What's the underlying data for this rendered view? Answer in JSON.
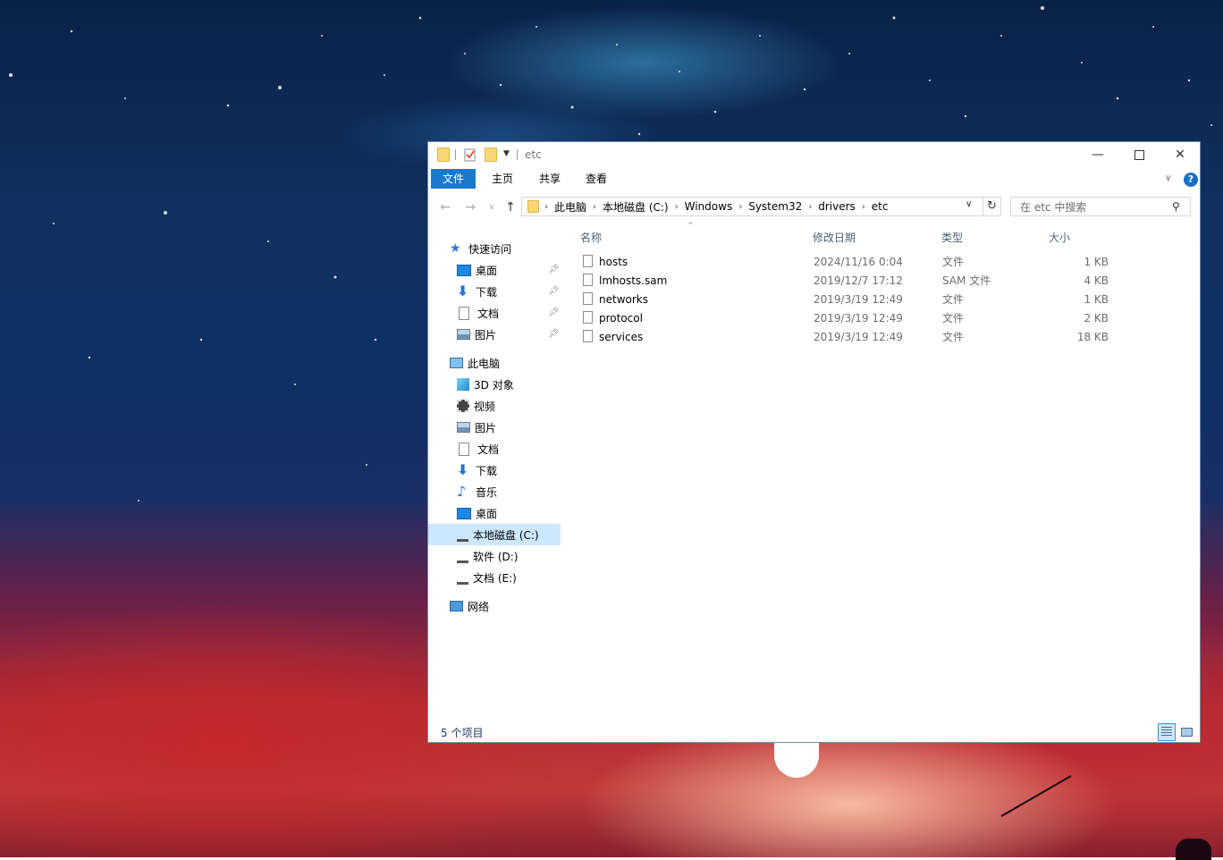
{
  "window": {
    "title": "etc",
    "ribbon_tabs": [
      "文件",
      "主页",
      "共享",
      "查看"
    ],
    "help_label": "?"
  },
  "address": {
    "crumbs": [
      "此电脑",
      "本地磁盘 (C:)",
      "Windows",
      "System32",
      "drivers",
      "etc"
    ]
  },
  "search": {
    "placeholder": "在 etc 中搜索"
  },
  "sidebar": {
    "quick_access": "快速访问",
    "quick_items": [
      "桌面",
      "下载",
      "文档",
      "图片"
    ],
    "this_pc": "此电脑",
    "pc_items": [
      "3D 对象",
      "视频",
      "图片",
      "文档",
      "下载",
      "音乐",
      "桌面",
      "本地磁盘 (C:)",
      "软件 (D:)",
      "文档 (E:)"
    ],
    "network": "网络",
    "selected": "本地磁盘 (C:)"
  },
  "columns": {
    "name": "名称",
    "date": "修改日期",
    "type": "类型",
    "size": "大小"
  },
  "files": [
    {
      "name": "hosts",
      "date": "2024/11/16 0:04",
      "type": "文件",
      "size": "1 KB"
    },
    {
      "name": "lmhosts.sam",
      "date": "2019/12/7 17:12",
      "type": "SAM 文件",
      "size": "4 KB"
    },
    {
      "name": "networks",
      "date": "2019/3/19 12:49",
      "type": "文件",
      "size": "1 KB"
    },
    {
      "name": "protocol",
      "date": "2019/3/19 12:49",
      "type": "文件",
      "size": "2 KB"
    },
    {
      "name": "services",
      "date": "2019/3/19 12:49",
      "type": "文件",
      "size": "18 KB"
    }
  ],
  "status": {
    "item_count": "5 个项目"
  },
  "colors": {
    "accent": "#1979ca",
    "selection": "#cce8ff"
  }
}
